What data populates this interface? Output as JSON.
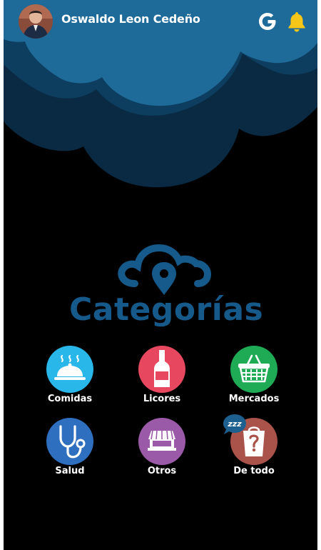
{
  "header": {
    "user_name": "Oswaldo Leon Cedeño",
    "avatar_icon": "user-photo",
    "google_icon": "google-g-icon",
    "notification_icon": "bell-icon"
  },
  "logo": {
    "title": "Categorías",
    "icon": "cloud-location-pin"
  },
  "categories": [
    {
      "label": "Comidas",
      "icon": "food-cloche-icon",
      "color": "#29b6e8"
    },
    {
      "label": "Licores",
      "icon": "bottle-icon",
      "color": "#e8485f"
    },
    {
      "label": "Mercados",
      "icon": "basket-icon",
      "color": "#1faa55"
    },
    {
      "label": "Salud",
      "icon": "stethoscope-icon",
      "color": "#2f6fc0"
    },
    {
      "label": "Otros",
      "icon": "store-icon",
      "color": "#9b5aa8"
    },
    {
      "label": "De todo",
      "icon": "mystery-bag-icon",
      "color": "#a9534a"
    }
  ],
  "badge": {
    "text": "zzz"
  },
  "colors": {
    "background": "#000000",
    "cloud_light": "#1e6a99",
    "cloud_mid": "#0d3e5f",
    "cloud_dark": "#092a42",
    "logo_blue": "#155a8a",
    "bell": "#f5c518"
  }
}
